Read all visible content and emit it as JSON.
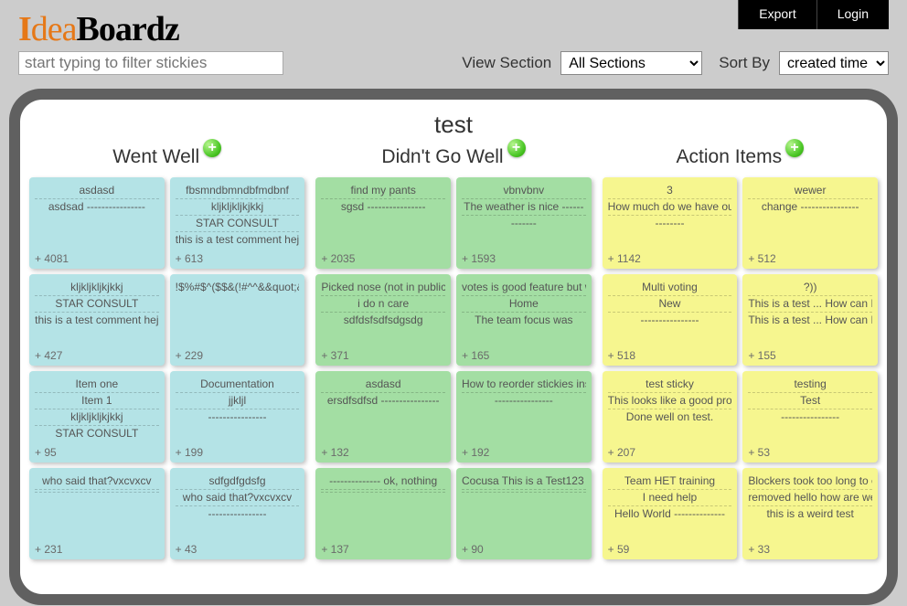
{
  "nav": {
    "export": "Export",
    "login": "Login"
  },
  "logo": {
    "i": "I",
    "dea": "dea",
    "boardz": "Boardz"
  },
  "filter": {
    "placeholder": "start typing to filter stickies"
  },
  "controls": {
    "view_label": "View Section",
    "section_value": "All Sections",
    "sort_label": "Sort By",
    "sort_value": "created time"
  },
  "board": {
    "title": "test"
  },
  "columns": [
    {
      "title": "Went Well",
      "color": "c-blue",
      "cards": [
        {
          "lines": [
            "asdasd",
            "asdsad ----------------"
          ],
          "votes": "+ 4081"
        },
        {
          "lines": [
            "fbsmndbmndbfmdbnf",
            "kljkljkljkjkkj",
            "STAR CONSULT",
            "this is a test comment hej"
          ],
          "votes": "+ 613"
        },
        {
          "lines": [
            "kljkljkljkjkkj",
            "STAR CONSULT",
            "this is a test comment hej"
          ],
          "votes": "+ 427"
        },
        {
          "lines": [
            "!$%#$^($$&(!#^^&&quot;&quot;&quot;\"&&quot;&quot;<><>"
          ],
          "votes": "+ 229"
        },
        {
          "lines": [
            "Item one",
            "Item 1",
            "kljkljkljkjkkj",
            "STAR CONSULT"
          ],
          "votes": "+ 95"
        },
        {
          "lines": [
            "Documentation",
            "jjkljl",
            "----------------"
          ],
          "votes": "+ 199"
        },
        {
          "lines": [
            "who said that?vxcvxcv",
            " ",
            " "
          ],
          "votes": "+ 231"
        },
        {
          "lines": [
            "sdfgdfgdsfg",
            "who said that?vxcvxcv",
            "----------------"
          ],
          "votes": "+ 43"
        }
      ]
    },
    {
      "title": "Didn't Go Well",
      "color": "c-green",
      "cards": [
        {
          "lines": [
            "find my pants",
            "sgsd ----------------"
          ],
          "votes": "+ 2035"
        },
        {
          "lines": [
            "vbnvbnv",
            "The weather is nice ------",
            "-------"
          ],
          "votes": "+ 1593"
        },
        {
          "lines": [
            "Picked nose (not in public) - then again what's wrong with doing it in public?",
            "i do n care",
            "sdfdsfsdfsdgsdg"
          ],
          "votes": "+ 371"
        },
        {
          "lines": [
            "votes is good feature but what for aged problems and actions that failed? -",
            "Home",
            "The team focus was"
          ],
          "votes": "+ 165"
        },
        {
          "lines": [
            "asdasd",
            "ersdfsdfsd ----------------"
          ],
          "votes": "+ 132"
        },
        {
          "lines": [
            "How to reorder stickies instead of merge them? --",
            "----------------"
          ],
          "votes": "+ 192"
        },
        {
          "lines": [
            "-------------- ok, nothing",
            " ",
            " "
          ],
          "votes": "+ 137"
        },
        {
          "lines": [
            "Cocusa This is a Test123 --",
            " ",
            " "
          ],
          "votes": "+ 90"
        }
      ]
    },
    {
      "title": "Action Items",
      "color": "c-yellow",
      "cards": [
        {
          "lines": [
            "3",
            "How much do we have outstanding for recovery -",
            "--------"
          ],
          "votes": "+ 1142"
        },
        {
          "lines": [
            "wewer",
            "change ----------------"
          ],
          "votes": "+ 512"
        },
        {
          "lines": [
            "Multi voting",
            "New",
            "----------------"
          ],
          "votes": "+ 518"
        },
        {
          "lines": [
            "?))",
            "This is a test ... How can I update this?",
            "This is a test ... How can I update this?"
          ],
          "votes": "+ 155"
        },
        {
          "lines": [
            "test sticky",
            "This looks like a good program.",
            "Done well on test."
          ],
          "votes": "+ 207"
        },
        {
          "lines": [
            "testing",
            "Test",
            "----------------"
          ],
          "votes": "+ 53"
        },
        {
          "lines": [
            "Team HET training",
            "I need help",
            "Hello World --------------"
          ],
          "votes": "+ 59"
        },
        {
          "lines": [
            "Blockers took too long to close",
            "removed hello how are we doing this is now edited",
            "this is a weird test"
          ],
          "votes": "+ 33"
        }
      ]
    }
  ],
  "chart_data": {
    "type": "table",
    "title": "test",
    "columns": [
      "Went Well",
      "Didn't Go Well",
      "Action Items"
    ],
    "data": {
      "Went Well": [
        {
          "text": "asdasd / asdsad",
          "votes": 4081
        },
        {
          "text": "fbsmndbmndbfmdbnf / kljkljkljkjkkj / STAR CONSULT / this is a test comment hej",
          "votes": 613
        },
        {
          "text": "kljkljkljkjkkj / STAR CONSULT / this is a test comment hej",
          "votes": 427
        },
        {
          "text": "!$%#$^($$& ... <><>",
          "votes": 229
        },
        {
          "text": "Item one / Item 1 / kljkljkljkjkkj / STAR CONSULT",
          "votes": 95
        },
        {
          "text": "Documentation / jjkljl",
          "votes": 199
        },
        {
          "text": "who said that?vxcvxcv",
          "votes": 231
        },
        {
          "text": "sdfgdfgdsfg / who said that?vxcvxcv",
          "votes": 43
        }
      ],
      "Didn't Go Well": [
        {
          "text": "find my pants / sgsd",
          "votes": 2035
        },
        {
          "text": "vbnvbnv / The weather is nice",
          "votes": 1593
        },
        {
          "text": "Picked nose (not in public) ... / i do n care / sdfdsfsdfsdgsdg",
          "votes": 371
        },
        {
          "text": "votes is good feature but what for aged problems and actions that failed? / Home / The team focus was",
          "votes": 165
        },
        {
          "text": "asdasd / ersdfsdfsd",
          "votes": 132
        },
        {
          "text": "How to reorder stickies instead of merge them?",
          "votes": 192
        },
        {
          "text": "ok, nothing",
          "votes": 137
        },
        {
          "text": "Cocusa This is a Test123",
          "votes": 90
        }
      ],
      "Action Items": [
        {
          "text": "3 / How much do we have outstanding for recovery",
          "votes": 1142
        },
        {
          "text": "wewer / change",
          "votes": 512
        },
        {
          "text": "Multi voting / New",
          "votes": 518
        },
        {
          "text": "?)) / This is a test ... How can I update this? (x2)",
          "votes": 155
        },
        {
          "text": "test sticky / This looks like a good program. / Done well on test.",
          "votes": 207
        },
        {
          "text": "testing / Test",
          "votes": 53
        },
        {
          "text": "Team HET training / I need help / Hello World",
          "votes": 59
        },
        {
          "text": "Blockers took too long to close / removed hello how are we doing this is now edited / this is a weird test",
          "votes": 33
        }
      ]
    }
  }
}
